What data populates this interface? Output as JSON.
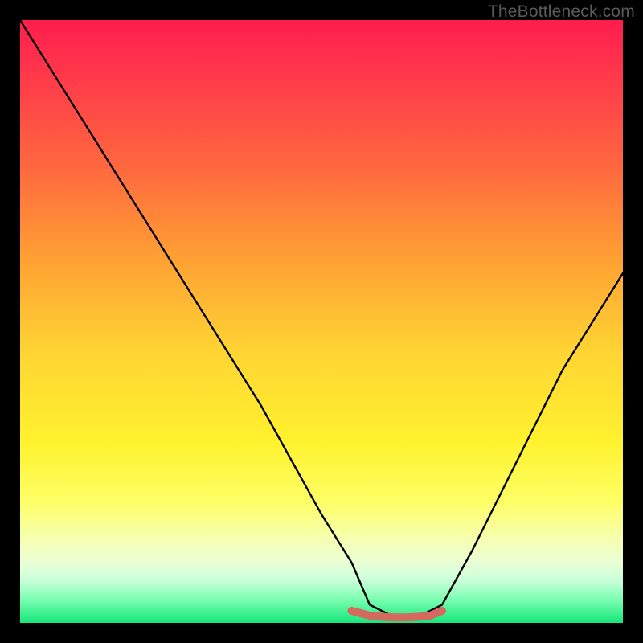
{
  "watermark": "TheBottleneck.com",
  "chart_data": {
    "type": "line",
    "title": "",
    "xlabel": "",
    "ylabel": "",
    "xlim": [
      0,
      100
    ],
    "ylim": [
      0,
      100
    ],
    "grid": false,
    "legend": false,
    "series": [
      {
        "name": "bottleneck-curve",
        "x": [
          0,
          5,
          10,
          15,
          20,
          25,
          30,
          35,
          40,
          45,
          50,
          55,
          58,
          62,
          66,
          70,
          75,
          80,
          85,
          90,
          95,
          100
        ],
        "values": [
          100,
          92,
          84,
          76,
          68,
          60,
          52,
          44,
          36,
          27,
          18,
          10,
          3,
          1,
          1,
          3,
          12,
          22,
          32,
          42,
          50,
          58
        ]
      },
      {
        "name": "flat-bottom-band",
        "x": [
          55,
          58,
          60,
          62,
          64,
          66,
          68,
          70
        ],
        "values": [
          2,
          1.2,
          1,
          0.9,
          0.9,
          1,
          1.2,
          2
        ]
      }
    ],
    "colors": {
      "curve": "#000000",
      "band": "#d46a5f",
      "gradient_top": "#ff1d4d",
      "gradient_mid": "#ffd433",
      "gradient_bottom": "#16e67a"
    }
  }
}
